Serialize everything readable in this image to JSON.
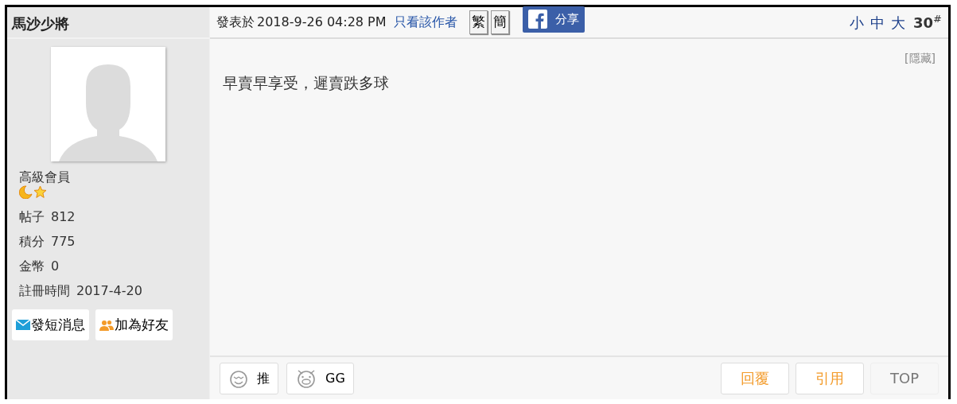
{
  "author": {
    "name": "馬沙少將",
    "rank": "高級會員",
    "stats": [
      {
        "label": "帖子",
        "value": "812"
      },
      {
        "label": "積分",
        "value": "775"
      },
      {
        "label": "金幣",
        "value": "0"
      },
      {
        "label": "註冊時間",
        "value": "2017-4-20"
      }
    ],
    "actions": [
      {
        "kind": "message",
        "label": "發短消息"
      },
      {
        "kind": "friend",
        "label": "加為好友"
      }
    ]
  },
  "post": {
    "posted_label": "發表於",
    "posted_time": "2018-9-26 04:28 PM",
    "author_only": "只看該作者",
    "script_buttons": [
      "繁",
      "簡"
    ],
    "share": "分享",
    "font_sizes": [
      "小",
      "中",
      "大"
    ],
    "floor": "30",
    "floor_mark": "#",
    "hide": "[隱藏]",
    "body": "早賣早享受，遲賣跌多球",
    "reactions": [
      {
        "kind": "smile",
        "label": "推"
      },
      {
        "kind": "pig",
        "label": "GG"
      }
    ],
    "actions": [
      {
        "kind": "accent",
        "label": "回覆"
      },
      {
        "kind": "accent",
        "label": "引用"
      },
      {
        "kind": "plain",
        "label": "TOP"
      }
    ]
  }
}
